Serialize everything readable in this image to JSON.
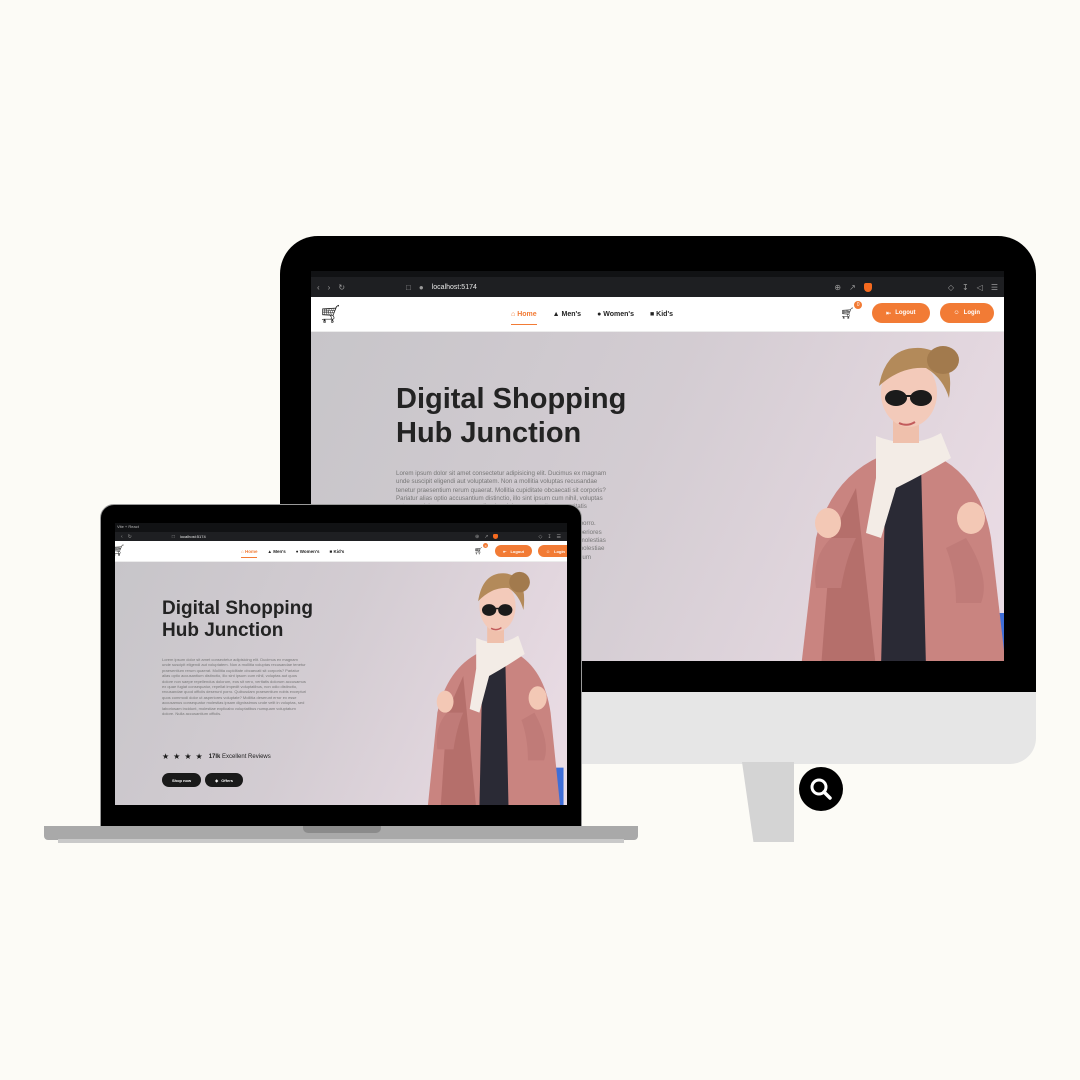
{
  "browser": {
    "url": "localhost:5174",
    "laptop_url": "localhost:5174",
    "laptop_tab_title": "Vite + React"
  },
  "nav": {
    "items": [
      {
        "label": "Home",
        "icon": "home-icon"
      },
      {
        "label": "Men's",
        "icon": "hanger-icon"
      },
      {
        "label": "Women's",
        "icon": "dress-icon"
      },
      {
        "label": "Kid's",
        "icon": "child-icon"
      }
    ],
    "cart_count": "0",
    "logout_label": "Logout",
    "login_label": "Login"
  },
  "hero": {
    "title_line1": "Digital Shopping",
    "title_line2": "Hub Junction",
    "body": "Lorem ipsum dolor sit amet consectetur adipisicing elit. Ducimus ex magnam unde suscipit eligendi aut voluptatem. Non a mollitia voluptas recusandae tenetur praesentium rerum quaerat. Mollitia cupiditate obcaecati sit corporis? Pariatur alias optio accusantium distinctio, illo sint ipsum cum nihil, voluptas aut quos dolore non saepe repellendus dolorum, eos sit vero, veritatis dolorum accusamus ex quae fugiat consequatur, repellat impedit voluptatibus, non odio distinctio, recusandae quod officiis deserunt porro. Quibusdam praesentium nobis excepturi quos commodi dolor ut asperiores voluptate? Mollitia deserunt error ex esse accusamus consequatur molestias ipsam dignissimos unde velit in voluptas, sed laboriosam incidunt, molestiae explicabo voluptatibus numquam voluptatum dolore. Nulla accusantium officiis.",
    "reviews_count": "17lk",
    "reviews_label": "Excellent Reviews",
    "rating": 4,
    "shop_label": "Shop now",
    "offers_label": "Offers"
  },
  "colors": {
    "accent": "#f27b35",
    "page_bg": "#fcfbf6"
  }
}
